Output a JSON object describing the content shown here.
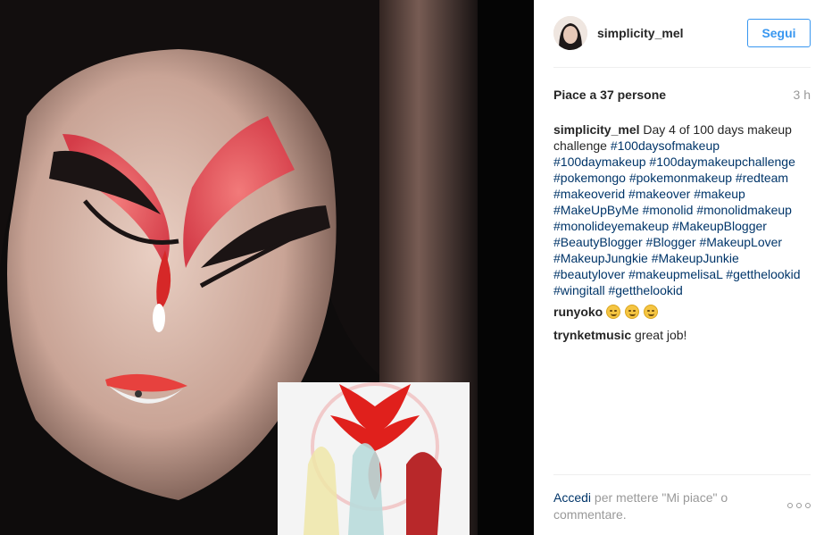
{
  "post": {
    "username": "simplicity_mel",
    "follow_label": "Segui",
    "likes_text": "Piace a 37 persone",
    "time_ago": "3 h"
  },
  "caption": {
    "user": "simplicity_mel",
    "text": "Day 4 of 100 days makeup challenge",
    "hashtags": [
      "#100daysofmakeup",
      "#100daymakeup",
      "#100daymakeupchallenge",
      "#pokemongo",
      "#pokemonmakeup",
      "#redteam",
      "#makeoverid",
      "#makeover",
      "#makeup",
      "#MakeUpByMe",
      "#monolid",
      "#monolidmakeup",
      "#monolideyemakeup",
      "#MakeupBlogger",
      "#BeautyBlogger",
      "#Blogger",
      "#MakeupLover",
      "#MakeupJungkie",
      "#MakeupJunkie",
      "#beautylover",
      "#makeupmelisaL",
      "#getthelookid",
      "#wingitall",
      "#getthelookid"
    ]
  },
  "comments": [
    {
      "user": "runyoko",
      "text": "",
      "emojis": [
        "relieved-face-emoji",
        "sweat-smile-emoji",
        "grinning-face-emoji"
      ]
    },
    {
      "user": "trynketmusic",
      "text": "great job!"
    }
  ],
  "footer": {
    "login_label": "Accedi",
    "rest_text": "per mettere \"Mi piace\" o commentare."
  },
  "icons": {
    "more": "more-options-icon",
    "avatar": "avatar"
  },
  "colors": {
    "follow_blue": "#3897f0",
    "link_navy": "#003569",
    "muted_gray": "#999999",
    "team_valor_red": "#e0201c"
  }
}
